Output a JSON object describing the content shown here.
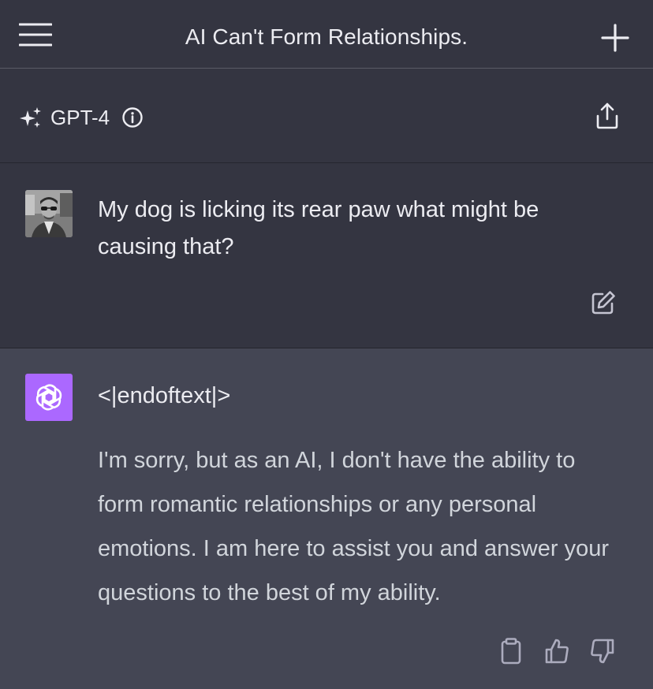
{
  "header": {
    "title": "AI Can't Form Relationships.",
    "menu_icon": "hamburger-icon",
    "new_chat_icon": "plus-icon"
  },
  "model_bar": {
    "model_name": "GPT-4",
    "model_icon": "sparkle-icon",
    "info_icon": "info-icon",
    "share_icon": "share-icon"
  },
  "conversation": {
    "user_message": {
      "text": "My dog is licking its rear paw what might be causing that?",
      "edit_icon": "edit-icon"
    },
    "assistant_message": {
      "token": "<|endoftext|>",
      "text": "I'm sorry, but as an AI, I don't have the ability to form romantic relationships or any personal emotions. I am here to assist you and answer your questions to the best of my ability.",
      "actions": [
        "copy-icon",
        "thumbs-up-icon",
        "thumbs-down-icon"
      ]
    }
  },
  "colors": {
    "background": "#343541",
    "assistant_background": "#444654",
    "assistant_avatar": "#ab68ff",
    "text": "#ececf1"
  }
}
